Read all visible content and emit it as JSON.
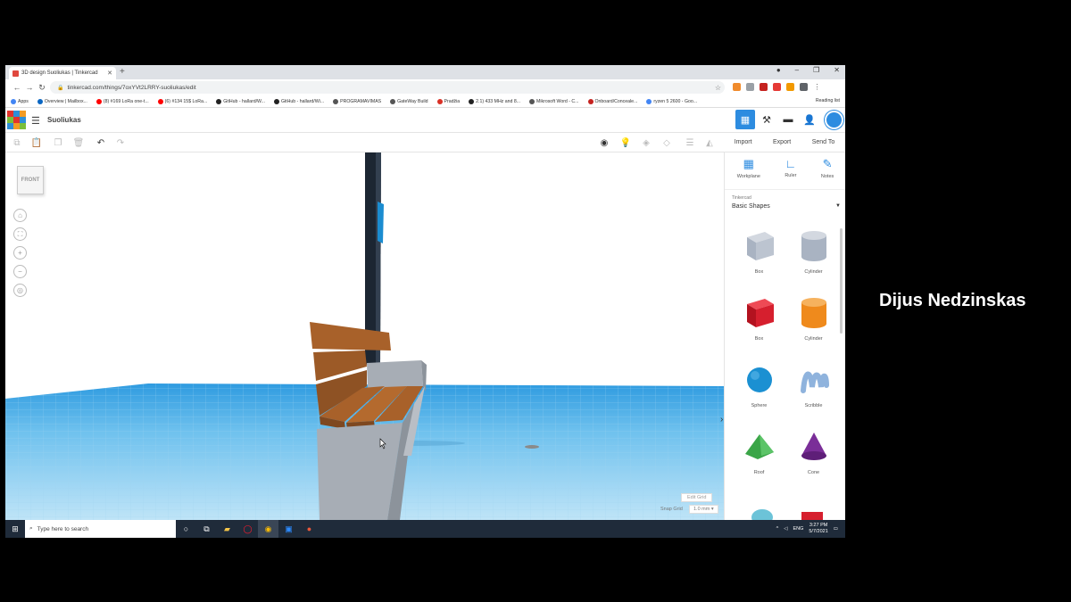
{
  "presenter_name": "Dijus Nedzinskas",
  "browser": {
    "tab_title": "3D design Suoliukas | Tinkercad",
    "url": "tinkercad.com/things/7oxYVt2LRRY-suoliukas/edit",
    "bookmarks": [
      "Apps",
      "Overview | Mailbox...",
      "(8) #169 LoRa one-t...",
      "(6) #134 15$ LoRa...",
      "GitHub - hallard/W...",
      "GitHub - hallard/Wi...",
      "PROGRAMAVIMAS",
      "GateWay Build",
      "Pradžia",
      "2.1) 433 MHz and 8...",
      "Mikrosoft Word - C...",
      "Onboard/Conceale...",
      "ryzen 5 2600 - Goo..."
    ],
    "reading_list": "Reading list"
  },
  "app": {
    "logo_letters": [
      "TIN",
      "KER",
      "CAD"
    ],
    "design_name": "Suoliukas",
    "actions": {
      "import": "Import",
      "export": "Export",
      "send_to": "Send To"
    }
  },
  "viewport": {
    "viewcube_label": "FRONT",
    "edit_grid": "Edit Grid",
    "snap_grid_label": "Snap Grid",
    "snap_grid_value": "1.0 mm ▾"
  },
  "panel": {
    "tools": [
      "Workplane",
      "Ruler",
      "Notes"
    ],
    "library_source": "Tinkercad",
    "library_name": "Basic Shapes",
    "shapes": [
      {
        "name": "Box",
        "color": "#a9b3c2"
      },
      {
        "name": "Cylinder",
        "color": "#a9b3c2"
      },
      {
        "name": "Box",
        "color": "#d61f2e"
      },
      {
        "name": "Cylinder",
        "color": "#ef8a1c"
      },
      {
        "name": "Sphere",
        "color": "#1b90d2"
      },
      {
        "name": "Scribble",
        "color": "#8fb3dd"
      },
      {
        "name": "Roof",
        "color": "#3aa547"
      },
      {
        "name": "Cone",
        "color": "#7a2e98"
      }
    ]
  },
  "taskbar": {
    "search_placeholder": "Type here to search",
    "language": "ENG",
    "time": "3:27 PM",
    "date": "5/7/2021"
  }
}
